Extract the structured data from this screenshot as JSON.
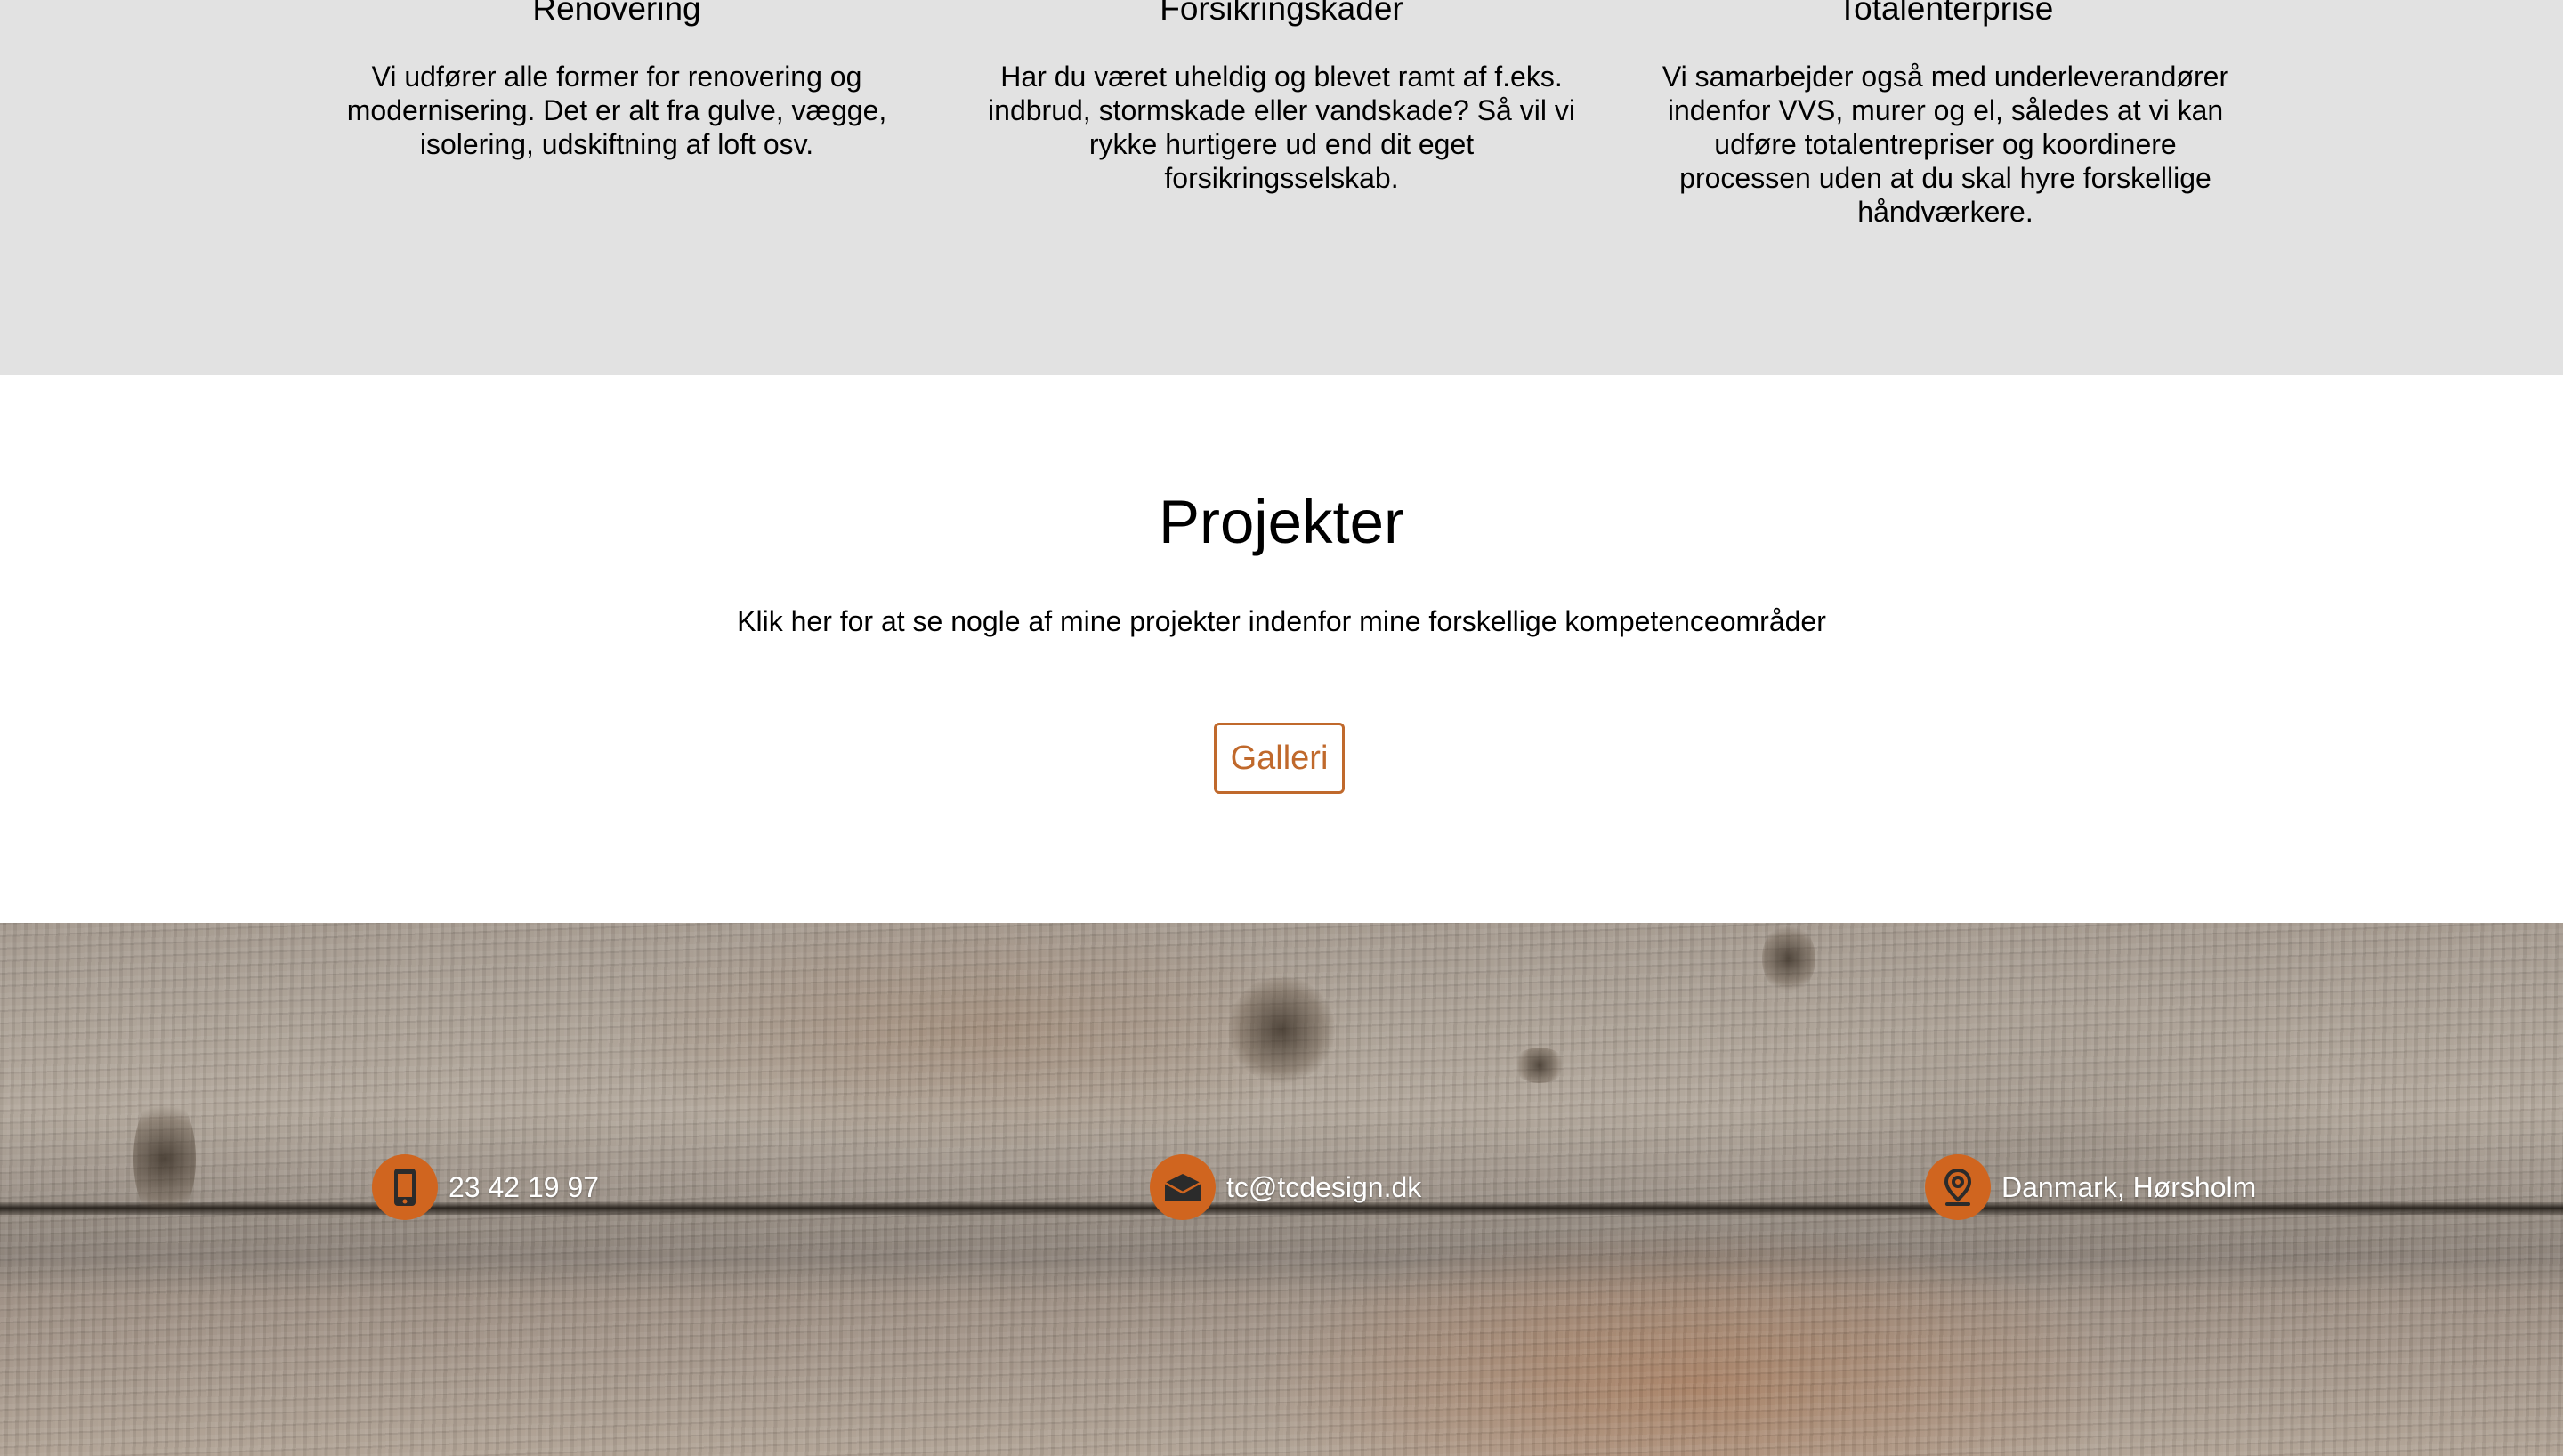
{
  "services": [
    {
      "title": "Renovering",
      "description": "Vi udfører alle former for renovering og modernisering. Det er alt fra gulve, vægge, isolering, udskiftning af loft osv."
    },
    {
      "title": "Forsikringskader",
      "description": "Har du været uheldig og blevet ramt af f.eks. indbrud, stormskade eller vandskade? Så vil vi rykke hurtigere ud end dit eget forsikringsselskab."
    },
    {
      "title": "Totalenterprise",
      "description": "Vi samarbejder også med underleverandører indenfor VVS, murer og el, således at vi kan udføre totalentrepriser og koordinere processen uden at du skal hyre forskellige håndværkere."
    }
  ],
  "projects": {
    "title": "Projekter",
    "text": "Klik her for at se nogle af mine projekter indenfor mine forskellige kompetenceområder",
    "button_label": "Galleri"
  },
  "contact": {
    "phone": "23 42 19 97",
    "email": "tc@tcdesign.dk",
    "location": "Danmark, Hørsholm"
  },
  "colors": {
    "accent": "#c0692c",
    "icon_bg": "#d0651f",
    "services_bg": "#e2e2e2"
  },
  "icons": {
    "phone": "phone-icon",
    "email": "envelope-icon",
    "location": "map-pin-icon"
  }
}
